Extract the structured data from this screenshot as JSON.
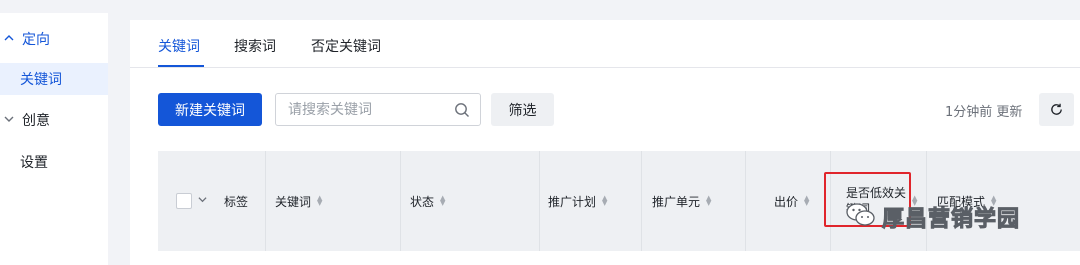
{
  "sidebar": {
    "items": [
      {
        "label": "定向",
        "chevron": "up"
      },
      {
        "label": "关键词"
      },
      {
        "label": "创意",
        "chevron": "down"
      },
      {
        "label": "设置"
      }
    ]
  },
  "tabs": [
    {
      "label": "关键词"
    },
    {
      "label": "搜索词"
    },
    {
      "label": "否定关键词"
    }
  ],
  "toolbar": {
    "new_label": "新建关键词",
    "search_placeholder": "请搜索关键词",
    "filter_label": "筛选",
    "update_text": "1分钟前 更新"
  },
  "table": {
    "columns": [
      "标签",
      "关键词",
      "状态",
      "推广计划",
      "推广单元",
      "出价",
      "是否低效关键词",
      "匹配模式"
    ]
  },
  "watermark": {
    "text": "厚昌营销学园"
  },
  "colors": {
    "accent": "#1456d8",
    "highlight": "#e0252b"
  }
}
